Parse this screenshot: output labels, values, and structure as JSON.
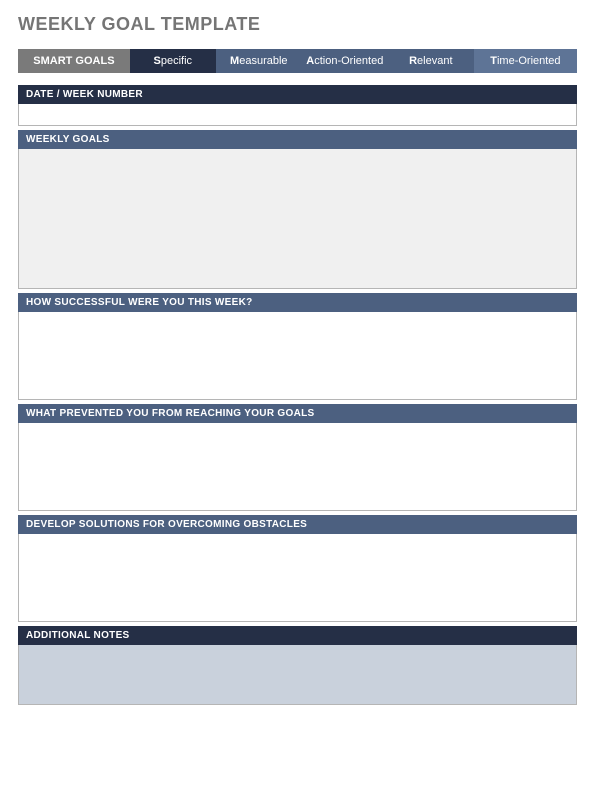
{
  "title": "WEEKLY GOAL TEMPLATE",
  "smart": {
    "goals": "SMART GOALS",
    "specific": {
      "initial": "S",
      "rest": "pecific"
    },
    "measurable": {
      "initial": "M",
      "rest": "easurable"
    },
    "action": {
      "initial": "A",
      "rest": "ction-Oriented"
    },
    "relevant": {
      "initial": "R",
      "rest": "elevant"
    },
    "time": {
      "initial": "T",
      "rest": "ime-Oriented"
    }
  },
  "sections": {
    "date": "DATE / WEEK NUMBER",
    "goals": "WEEKLY GOALS",
    "success": "HOW SUCCESSFUL WERE YOU THIS WEEK?",
    "prevented": "WHAT PREVENTED YOU FROM REACHING YOUR GOALS",
    "solutions": "DEVELOP SOLUTIONS FOR OVERCOMING OBSTACLES",
    "notes": "ADDITIONAL NOTES"
  }
}
